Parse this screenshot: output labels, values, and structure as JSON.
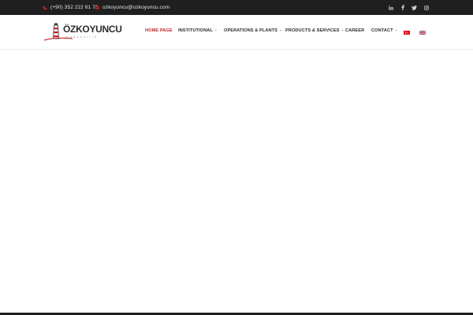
{
  "topbar": {
    "phone": "(+90) 352 222 61 71",
    "email": "ozkoyuncu@ozkoyuncu.com",
    "social": [
      "linkedin-icon",
      "facebook-icon",
      "twitter-icon",
      "instagram-icon"
    ]
  },
  "logo": {
    "brand": "ÖZKOYUNCU",
    "sub": "madencilik"
  },
  "nav": {
    "items": [
      {
        "label": "HOME PAGE"
      },
      {
        "label": "INSTITUTIONAL"
      },
      {
        "label": "OPERATIONS & PLANTS"
      },
      {
        "label": "PRODUCTS & SERVICES"
      },
      {
        "label": "CAREER"
      },
      {
        "label": "CONTACT"
      }
    ],
    "caret": "⌄"
  },
  "languages": [
    "tr-flag-icon",
    "en-flag-icon"
  ],
  "colors": {
    "accent": "#c0262d",
    "topbar": "#1f1f1f"
  }
}
